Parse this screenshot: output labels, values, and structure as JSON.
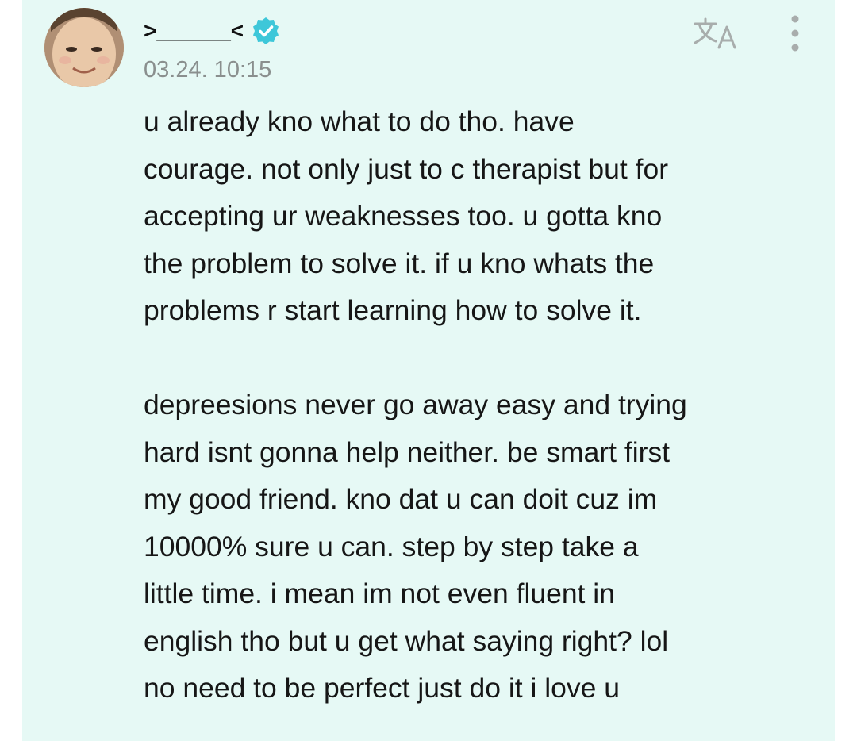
{
  "post": {
    "author": {
      "display_name": ">______<",
      "verified": true
    },
    "timestamp": "03.24. 10:15",
    "paragraphs": [
      "u already kno what to do tho. have\ncourage. not only just to c therapist but for\naccepting ur weaknesses too. u gotta kno\nthe problem to solve it. if u kno  whats the\nproblems r start learning how to solve it.",
      "depreesions never go away easy and trying\nhard isnt gonna help neither. be smart first\nmy good friend. kno dat u can  doit cuz im\n10000% sure u can. step by step take a\nlittle time. i mean im not even fluent in\nenglish tho but u get what saying right? lol\nno need to be perfect just do it  i love u"
    ]
  },
  "actions": {
    "translate_icon": "translate-icon",
    "more_icon": "more-vertical-icon"
  },
  "colors": {
    "card_background": "#e6f9f5",
    "verified_badge": "#3dc7d9",
    "timestamp": "#8a8f8e",
    "text": "#161616",
    "icon_gray": "#a8adac"
  }
}
